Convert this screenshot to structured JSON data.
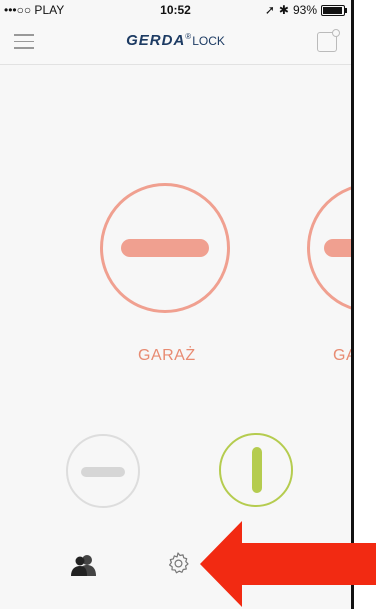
{
  "status_bar": {
    "carrier": "•••○○ PLAY",
    "time": "10:52",
    "battery": "93%"
  },
  "header": {
    "brand": "GERDA",
    "brand_suffix": "LOCK"
  },
  "locks": [
    {
      "label": "GARAŻ"
    },
    {
      "label": "GA"
    }
  ],
  "colors": {
    "lock_accent": "#f0a090",
    "label": "#e88b72",
    "active_green": "#b5cc4f",
    "arrow": "#f22a12"
  }
}
